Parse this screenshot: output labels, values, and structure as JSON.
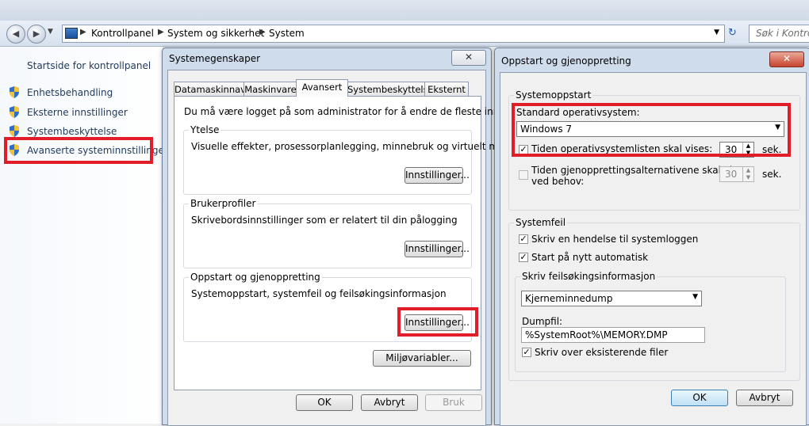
{
  "breadcrumb": [
    "Kontrollpanel",
    "System og sikkerhet",
    "System"
  ],
  "search_placeholder": "Søk i Kontrollpa",
  "left_pane": {
    "home": "Startside for kontrollpanel",
    "links": [
      "Enhetsbehandling",
      "Eksterne innstillinger",
      "Systembeskyttelse",
      "Avanserte systeminnstillinger"
    ]
  },
  "sysprops": {
    "title": "Systemegenskaper",
    "close": "✕",
    "tabs": [
      "Datamaskinnavn",
      "Maskinvare",
      "Avansert",
      "Systembeskyttelse",
      "Eksternt"
    ],
    "admin_note": "Du må være logget på som administrator for å endre de fleste innstillingene.",
    "perf": {
      "title": "Ytelse",
      "desc": "Visuelle effekter, prosessorplanlegging, minnebruk og virtuelt minne",
      "button": "Innstillinger..."
    },
    "profiles": {
      "title": "Brukerprofiler",
      "desc": "Skrivebordsinnstillinger som er relatert til din pålogging",
      "button": "Innstillinger..."
    },
    "startup": {
      "title": "Oppstart og gjenoppretting",
      "desc": "Systemoppstart, systemfeil og feilsøkingsinformasjon",
      "button": "Innstillinger..."
    },
    "env_button": "Miljøvariabler...",
    "ok": "OK",
    "cancel": "Avbryt",
    "apply": "Bruk"
  },
  "startup_dialog": {
    "title": "Oppstart og gjenoppretting",
    "close": "✕",
    "system_startup": {
      "title": "Systemoppstart",
      "default_os_label": "Standard operativsystem:",
      "default_os_value": "Windows 7",
      "os_list_label": "Tiden operativsystemlisten skal vises:",
      "os_list_value": "30",
      "sec": "sek.",
      "recovery_label_1": "Tiden gjenopprettingsalternativene skal vises,",
      "recovery_label_2": "ved behov:",
      "recovery_value": "30",
      "sec2": "sek."
    },
    "system_failure": {
      "title": "Systemfeil",
      "write_event": "Skriv en hendelse til systemloggen",
      "auto_restart": "Start på nytt automatisk",
      "debug_title": "Skriv feilsøkingsinformasjon",
      "debug_value": "Kjerneminnedump",
      "dumpfile_label": "Dumpfil:",
      "dumpfile_value": "%SystemRoot%\\MEMORY.DMP",
      "overwrite": "Skriv over eksisterende filer"
    },
    "ok": "OK",
    "cancel": "Avbryt"
  },
  "colors": {
    "highlight": "#e11d2a",
    "link": "#1e395b"
  }
}
